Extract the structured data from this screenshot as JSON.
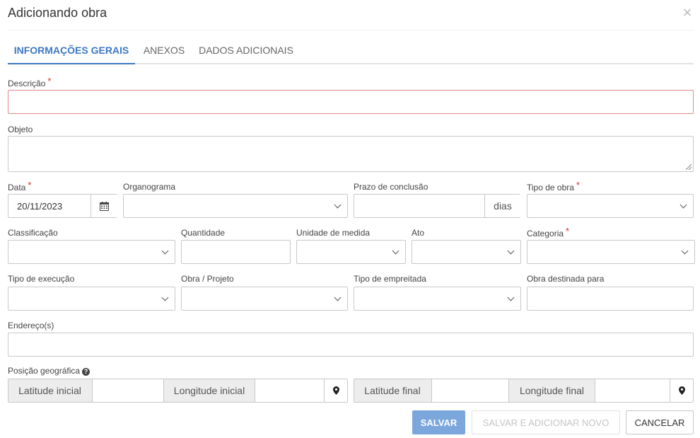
{
  "modal": {
    "title": "Adicionando obra"
  },
  "tabs": [
    "INFORMAÇÕES GERAIS",
    "ANEXOS",
    "DADOS ADICIONAIS"
  ],
  "fields": {
    "descricao": {
      "label": "Descrição",
      "required": "*"
    },
    "objeto": {
      "label": "Objeto"
    },
    "data": {
      "label": "Data",
      "required": "*",
      "value": "20/11/2023"
    },
    "organograma": {
      "label": "Organograma"
    },
    "prazo": {
      "label": "Prazo de conclusão",
      "suffix": "dias"
    },
    "tipo_obra": {
      "label": "Tipo de obra",
      "required": "*"
    },
    "classificacao": {
      "label": "Classificação"
    },
    "quantidade": {
      "label": "Quantidade"
    },
    "unidade": {
      "label": "Unidade de medida"
    },
    "ato": {
      "label": "Ato"
    },
    "categoria": {
      "label": "Categoria",
      "required": "*"
    },
    "tipo_execucao": {
      "label": "Tipo de execução"
    },
    "obra_projeto": {
      "label": "Obra / Projeto"
    },
    "tipo_empreitada": {
      "label": "Tipo de empreitada"
    },
    "obra_destinada": {
      "label": "Obra destinada para"
    },
    "enderecos": {
      "label": "Endereço(s)"
    },
    "posicao": {
      "label": "Posição geográfica",
      "help": "?"
    },
    "lat_inicial": {
      "label": "Latitude inicial"
    },
    "lon_inicial": {
      "label": "Longitude inicial"
    },
    "lat_final": {
      "label": "Latitude final"
    },
    "lon_final": {
      "label": "Longitude final"
    }
  },
  "buttons": {
    "save": "SALVAR",
    "save_new": "SALVAR E ADICIONAR NOVO",
    "cancel": "CANCELAR"
  },
  "icons": {
    "close": "close-icon",
    "calendar": "calendar-icon",
    "chevron": "chevron-down-icon",
    "map_marker": "map-marker-icon",
    "help": "question-circle-icon"
  },
  "colors": {
    "accent": "#3b78c4",
    "required": "#d9302b",
    "invalid_border": "#e08a8a",
    "save_button": "#7ca7dd"
  }
}
